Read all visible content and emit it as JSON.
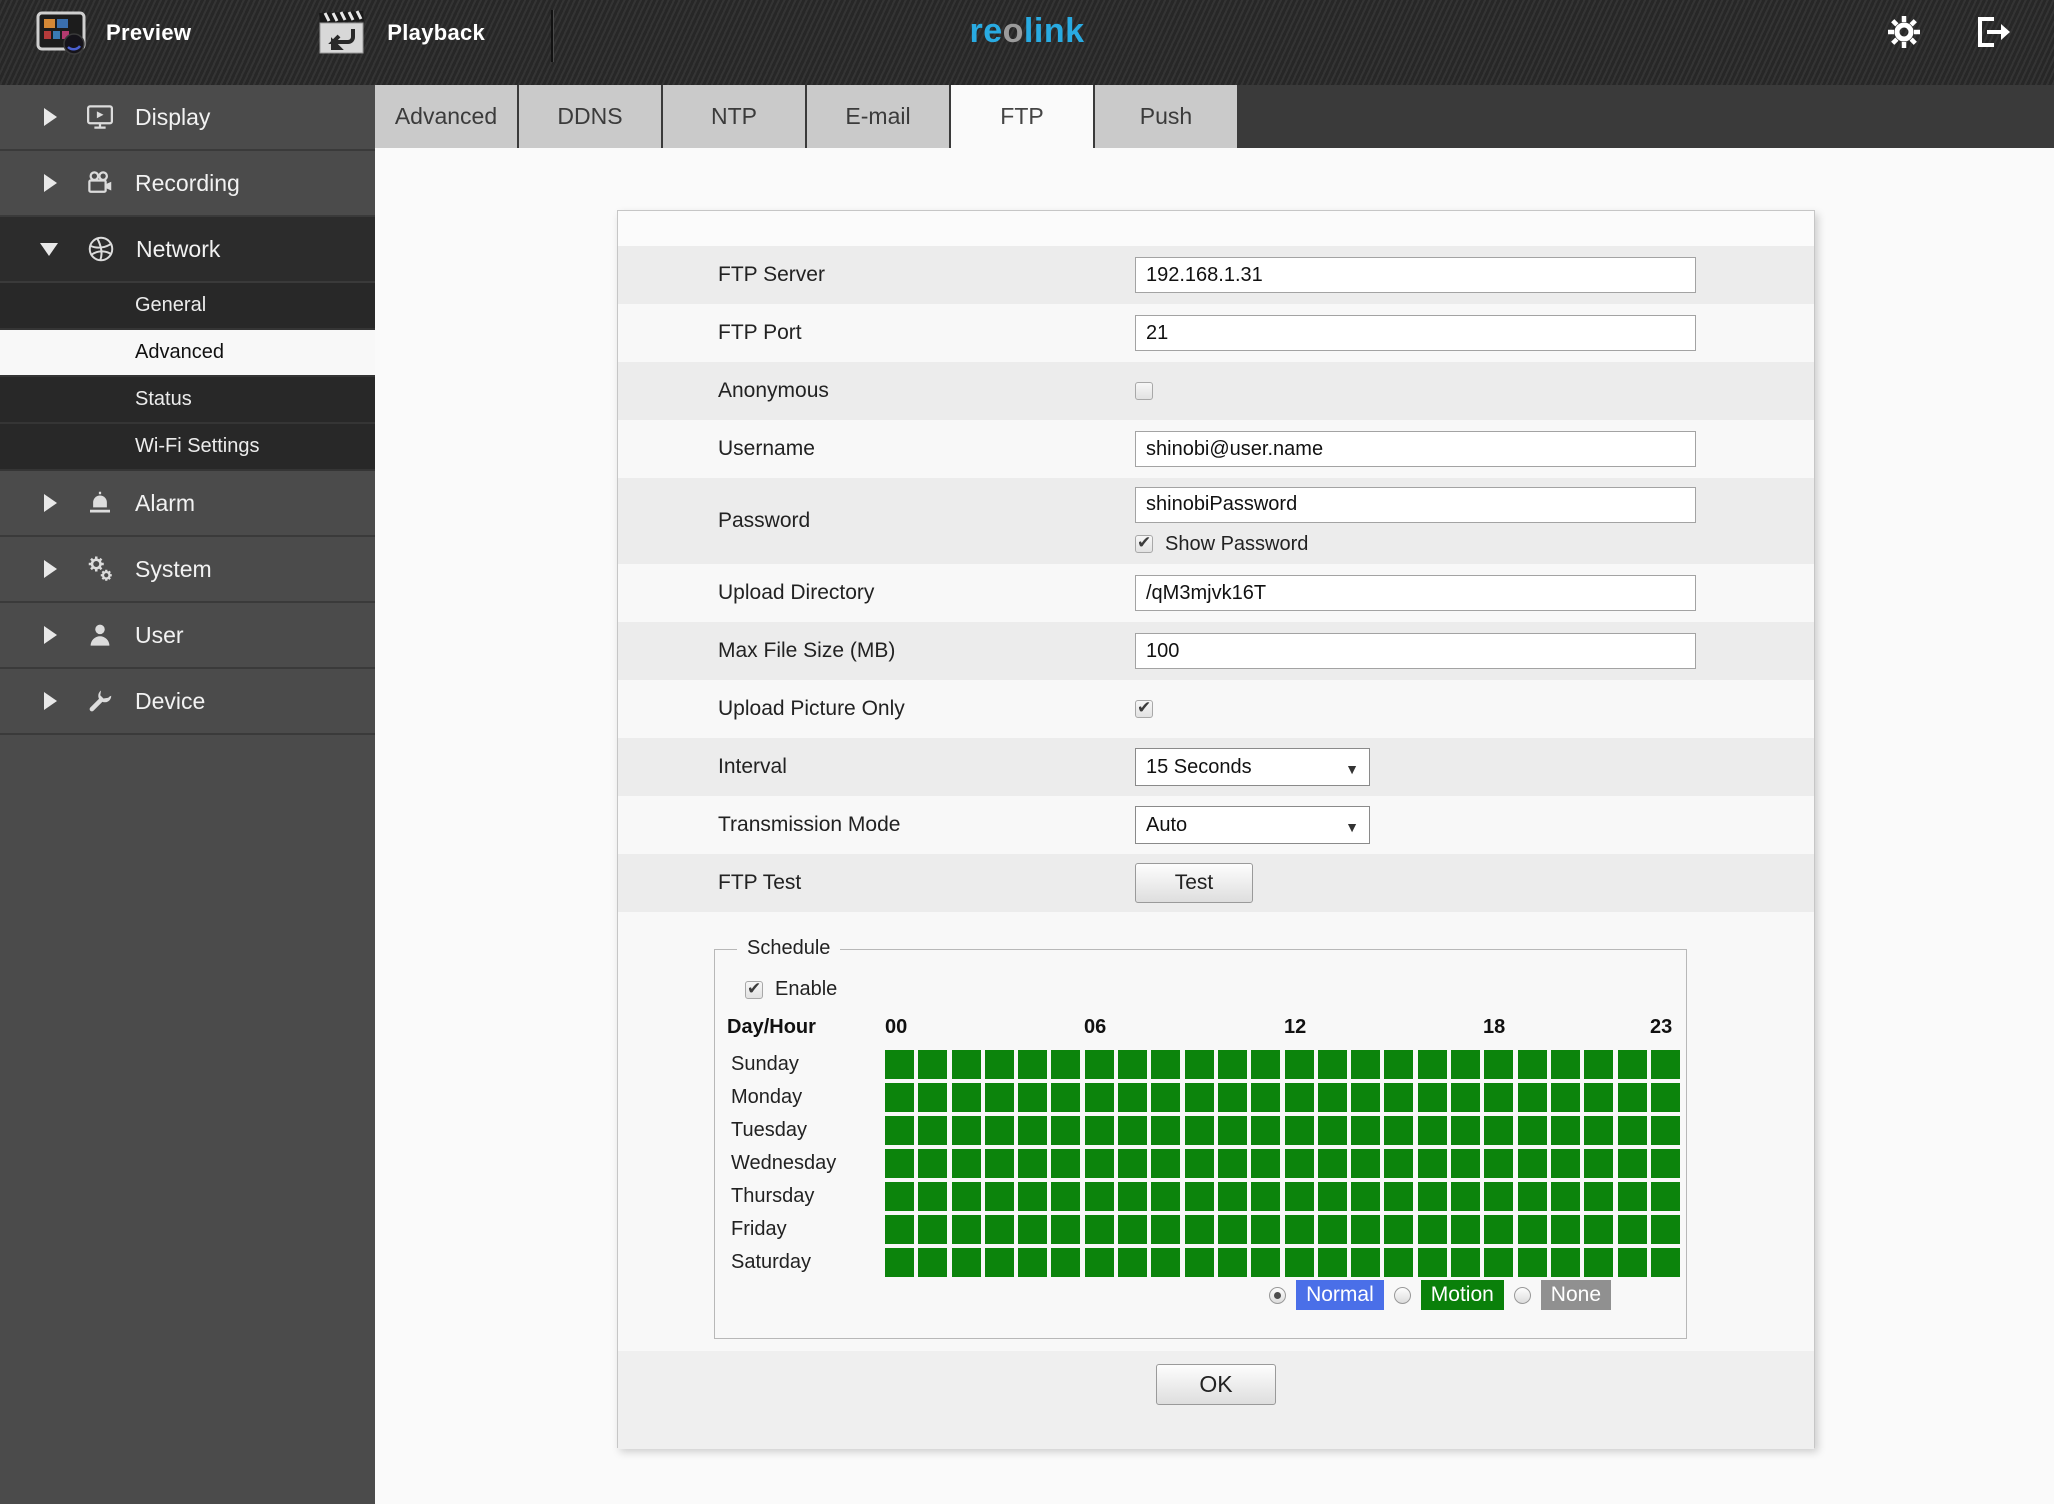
{
  "topbar": {
    "preview_label": "Preview",
    "playback_label": "Playback",
    "logo": {
      "part1": "re",
      "part2": "o",
      "part3": "link"
    }
  },
  "sidebar": {
    "items": [
      {
        "label": "Display"
      },
      {
        "label": "Recording"
      },
      {
        "label": "Network",
        "expanded": true
      },
      {
        "label": "Alarm"
      },
      {
        "label": "System"
      },
      {
        "label": "User"
      },
      {
        "label": "Device"
      }
    ],
    "network_children": [
      {
        "label": "General",
        "selected": false
      },
      {
        "label": "Advanced",
        "selected": true
      },
      {
        "label": "Status",
        "selected": false
      },
      {
        "label": "Wi-Fi Settings",
        "selected": false
      }
    ]
  },
  "tabs": [
    {
      "label": "Advanced"
    },
    {
      "label": "DDNS"
    },
    {
      "label": "NTP"
    },
    {
      "label": "E-mail"
    },
    {
      "label": "FTP",
      "active": true
    },
    {
      "label": "Push"
    }
  ],
  "form": {
    "ftp_server": {
      "label": "FTP Server",
      "value": "192.168.1.31"
    },
    "ftp_port": {
      "label": "FTP Port",
      "value": "21"
    },
    "anonymous": {
      "label": "Anonymous",
      "checked": false
    },
    "username": {
      "label": "Username",
      "value": "shinobi@user.name"
    },
    "password": {
      "label": "Password",
      "value": "shinobiPassword",
      "checkbox_label": "Show Password",
      "checked": true
    },
    "upload_directory": {
      "label": "Upload Directory",
      "value": "/qM3mjvk16T"
    },
    "max_file_size": {
      "label": "Max File Size (MB)",
      "value": "100"
    },
    "upload_picture": {
      "label": "Upload Picture Only",
      "checked": true
    },
    "interval": {
      "label": "Interval",
      "value": "15 Seconds"
    },
    "transmission_mode": {
      "label": "Transmission Mode",
      "value": "Auto"
    },
    "ftp_test": {
      "label": "FTP Test",
      "button_label": "Test"
    }
  },
  "schedule": {
    "legend": "Schedule",
    "enable_label": "Enable",
    "enabled": true,
    "header": "Day/Hour",
    "hours": [
      "00",
      "06",
      "12",
      "18",
      "23"
    ],
    "days": [
      "Sunday",
      "Monday",
      "Tuesday",
      "Wednesday",
      "Thursday",
      "Friday",
      "Saturday"
    ],
    "columns": 24,
    "all_cells_selected": true,
    "cell_color": "#0c840c",
    "modes": [
      {
        "label": "Normal",
        "color": "#4a6fe8",
        "selected": true
      },
      {
        "label": "Motion",
        "color": "#0a800a",
        "selected": false
      },
      {
        "label": "None",
        "color": "#909090",
        "selected": false
      }
    ]
  },
  "ok_label": "OK"
}
